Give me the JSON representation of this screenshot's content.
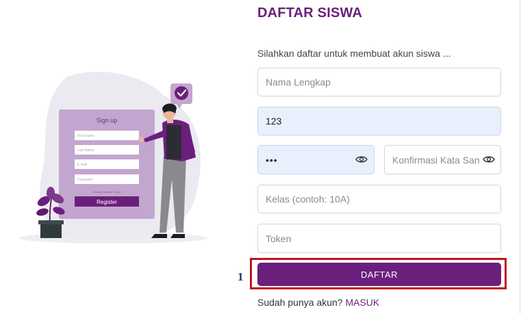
{
  "page": {
    "title": "DAFTAR SISWA",
    "subtitle": "Silahkan daftar untuk membuat akun siswa ..."
  },
  "form": {
    "full_name": {
      "placeholder": "Nama Lengkap",
      "value": ""
    },
    "nis": {
      "placeholder": "",
      "value": "123"
    },
    "password": {
      "placeholder": "",
      "value": "•••"
    },
    "confirm_password": {
      "placeholder": "Konfirmasi Kata Sandi",
      "value": ""
    },
    "class": {
      "placeholder": "Kelas (contoh: 10A)",
      "value": ""
    },
    "token": {
      "placeholder": "Token",
      "value": ""
    },
    "submit_label": "DAFTAR"
  },
  "footer": {
    "prompt": "Sudah punya akun? ",
    "login_link": "MASUK"
  },
  "annotation": {
    "marker": "1",
    "color": "#c0141a"
  },
  "illustration": {
    "card_title": "Sign up",
    "card_fields": [
      "First Name",
      "Last Name",
      "E-mail",
      "Password"
    ],
    "card_note": "Already a member? Log in",
    "card_button": "Register"
  },
  "colors": {
    "brand": "#6a1f7a",
    "button": "#6b1f7c",
    "autofill": "#e8f0fe"
  },
  "icons": {
    "eye": "eye-icon",
    "check": "check-icon"
  }
}
